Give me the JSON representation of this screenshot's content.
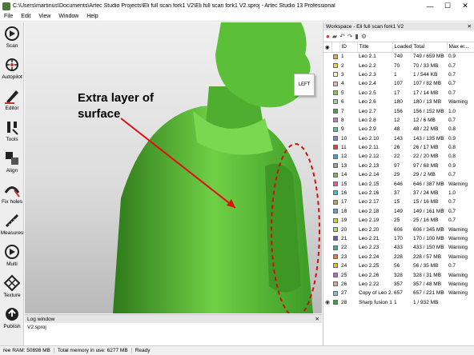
{
  "window": {
    "title": "C:\\Users\\martinus\\Documents\\Artec Studio Projects\\Eli full scan fork1 V2\\Eli full scan fork1 V2.sproj - Artec Studio 13 Professional",
    "minimize": "—",
    "maximize": "☐",
    "close": "✕"
  },
  "menu": [
    "File",
    "Edit",
    "View",
    "Window",
    "Help"
  ],
  "tools": [
    {
      "label": "Scan",
      "icon": "scan-icon"
    },
    {
      "label": "Autopilot",
      "icon": "autopilot-icon"
    },
    {
      "label": "Editor",
      "icon": "editor-icon"
    },
    {
      "label": "Tools",
      "icon": "tools-icon"
    },
    {
      "label": "Align",
      "icon": "align-icon"
    },
    {
      "label": "Fix holes",
      "icon": "fix-holes-icon"
    },
    {
      "label": "Measures",
      "icon": "measures-icon"
    },
    {
      "label": "Multi",
      "icon": "multi-icon"
    },
    {
      "label": "Texture",
      "icon": "texture-icon"
    },
    {
      "label": "Publish",
      "icon": "publish-icon"
    }
  ],
  "viewport": {
    "annotation_line1": "Extra layer of",
    "annotation_line2": "surface",
    "view_cube_label": "LEFT"
  },
  "log": {
    "title": "Log window",
    "text": "V2.sproj"
  },
  "workspace": {
    "title": "Workspace - Eli full scan fork1 V2",
    "columns": [
      "ID",
      "Title",
      "Loaded",
      "Total",
      "Max er..."
    ],
    "rows": [
      {
        "id": "1",
        "title": "Leo 2.1",
        "loaded": "749",
        "total": "749 / 659 MB",
        "max": "0.9",
        "color": "#e8a24a"
      },
      {
        "id": "2",
        "title": "Leo 2.2",
        "loaded": "70",
        "total": "70 / 33 MB",
        "max": "0.7",
        "color": "#e8d84a"
      },
      {
        "id": "3",
        "title": "Leo 2.3",
        "loaded": "1",
        "total": "1 / 544 KB",
        "max": "0.7",
        "color": "#f4f4c0"
      },
      {
        "id": "4",
        "title": "Leo 2.4",
        "loaded": "107",
        "total": "107 / 82 MB",
        "max": "0.7",
        "color": "#f0b0b0"
      },
      {
        "id": "5",
        "title": "Leo 2.5",
        "loaded": "17",
        "total": "17 / 14 MB",
        "max": "0.7",
        "color": "#8cc84a"
      },
      {
        "id": "6",
        "title": "Leo 2.6",
        "loaded": "180",
        "total": "180 / 13 MB",
        "max": "Warning",
        "color": "#a0d0a0"
      },
      {
        "id": "7",
        "title": "Leo 2.7",
        "loaded": "156",
        "total": "156 / 152 MB",
        "max": "1.0",
        "color": "#4aa04a"
      },
      {
        "id": "8",
        "title": "Leo 2.8",
        "loaded": "12",
        "total": "12 / 6 MB",
        "max": "0.7",
        "color": "#c080c0"
      },
      {
        "id": "9",
        "title": "Leo 2.9",
        "loaded": "48",
        "total": "48 / 22 MB",
        "max": "0.8",
        "color": "#60c0a0"
      },
      {
        "id": "10",
        "title": "Leo 2.10",
        "loaded": "143",
        "total": "143 / 135 MB",
        "max": "0.9",
        "color": "#8080e0"
      },
      {
        "id": "11",
        "title": "Leo 2.11",
        "loaded": "26",
        "total": "26 / 17 MB",
        "max": "0.8",
        "color": "#e04040"
      },
      {
        "id": "12",
        "title": "Leo 2.12",
        "loaded": "22",
        "total": "22 / 20 MB",
        "max": "0.8",
        "color": "#40a0e0"
      },
      {
        "id": "13",
        "title": "Leo 2.13",
        "loaded": "97",
        "total": "97 / 68 MB",
        "max": "0.9",
        "color": "#a0a0a0"
      },
      {
        "id": "14",
        "title": "Leo 2.14",
        "loaded": "29",
        "total": "29 / 2 MB",
        "max": "0.7",
        "color": "#80b060"
      },
      {
        "id": "15",
        "title": "Leo 2.15",
        "loaded": "646",
        "total": "646 / 387 MB",
        "max": "Warning",
        "color": "#e060a0"
      },
      {
        "id": "16",
        "title": "Leo 2.16",
        "loaded": "37",
        "total": "37 / 24 MB",
        "max": "1.0",
        "color": "#40c0c0"
      },
      {
        "id": "17",
        "title": "Leo 2.17",
        "loaded": "15",
        "total": "15 / 16 MB",
        "max": "0.7",
        "color": "#c0a060"
      },
      {
        "id": "18",
        "title": "Leo 2.18",
        "loaded": "149",
        "total": "149 / 161 MB",
        "max": "0.7",
        "color": "#60a0c0"
      },
      {
        "id": "19",
        "title": "Leo 2.19",
        "loaded": "25",
        "total": "25 / 16 MB",
        "max": "0.7",
        "color": "#d0d040"
      },
      {
        "id": "20",
        "title": "Leo 2.20",
        "loaded": "606",
        "total": "606 / 345 MB",
        "max": "Warning",
        "color": "#a0e060"
      },
      {
        "id": "21",
        "title": "Leo 2.21",
        "loaded": "170",
        "total": "170 / 100 MB",
        "max": "Warning",
        "color": "#6060c0"
      },
      {
        "id": "22",
        "title": "Leo 2.23",
        "loaded": "433",
        "total": "433 / 150 MB",
        "max": "Warning",
        "color": "#40b080"
      },
      {
        "id": "23",
        "title": "Leo 2.24",
        "loaded": "228",
        "total": "228 / 57 MB",
        "max": "Warning",
        "color": "#e08040"
      },
      {
        "id": "24",
        "title": "Leo 2.25",
        "loaded": "56",
        "total": "56 / 35 MB",
        "max": "0.7",
        "color": "#e0c040"
      },
      {
        "id": "25",
        "title": "Leo 2.26",
        "loaded": "328",
        "total": "328 / 31 MB",
        "max": "Warning",
        "color": "#c060e0"
      },
      {
        "id": "26",
        "title": "Leo 2.22",
        "loaded": "357",
        "total": "357 / 48 MB",
        "max": "Warning",
        "color": "#e0a0a0"
      },
      {
        "id": "27",
        "title": "Copy of Leo 2.2",
        "loaded": "657",
        "total": "657 / 221 MB",
        "max": "Warning",
        "color": "#80c0e0"
      },
      {
        "id": "28",
        "title": "Sharp fusion 1",
        "loaded": "1",
        "total": "1 / 932 MB",
        "max": "",
        "color": "#40a040"
      }
    ]
  },
  "status": {
    "free_ram": "ree RAM: 50898 MB",
    "total_memory": "Total memory in use: 6277 MB",
    "state": "Ready"
  }
}
